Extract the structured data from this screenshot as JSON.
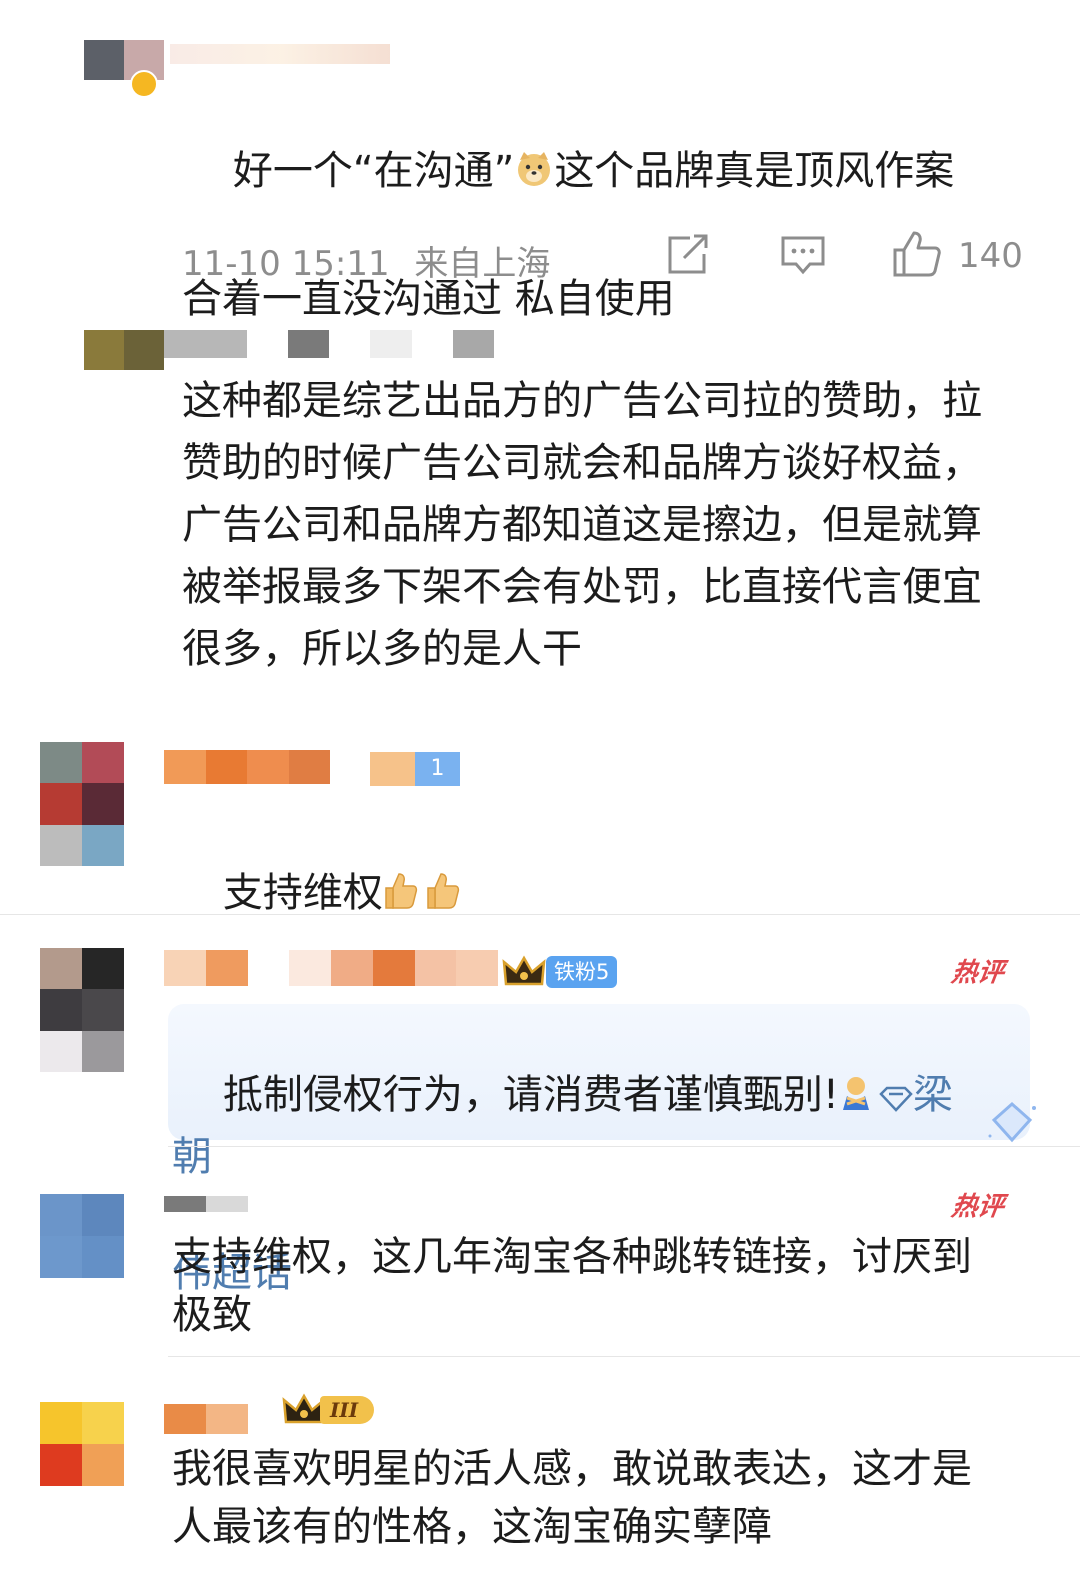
{
  "comments": [
    {
      "text_lines": [
        "好一个“在沟通”",
        "这个品牌真是顶风作案",
        "合着一直没沟通过 私自使用"
      ],
      "timestamp": "11-10 15:11",
      "location": "来自上海",
      "likes": "140",
      "emoji": "doge-emoji",
      "verified": true
    },
    {
      "text": "这种都是综艺出品方的广告公司拉的赞助，拉赞助的时候广告公司就会和品牌方谈好权益，广告公司和品牌方都知道这是擦边，但是就算被举报最多下架不会有处罚，比直接代言便宜很多，所以多的是人干"
    },
    {
      "text": "支持维权",
      "emoji": "thumbs-up-emoji",
      "badge_text": "1"
    },
    {
      "text_main": "抵制侵权行为，请消费者谨慎甄别!",
      "link_text_1": "梁朝",
      "link_text_2": "伟超话",
      "fan_badge": "铁粉5",
      "hot_label": "热评"
    },
    {
      "text": "支持维权，这几年淘宝各种跳转链接，讨厌到极致",
      "hot_label": "热评"
    },
    {
      "text": "我很喜欢明星的活人感，敢说敢表达，这才是人最该有的性格，这淘宝确实孽障",
      "vip_badge": "III"
    }
  ],
  "colors": {
    "text": "#1c1c1c",
    "meta": "#8d8d8d",
    "hot": "#e0484e",
    "link": "#507daf",
    "highlight_bg": "#eef4fd",
    "fan_badge_bg": "#5aa3f0",
    "vip_badge_bg": "#f2c14b"
  }
}
